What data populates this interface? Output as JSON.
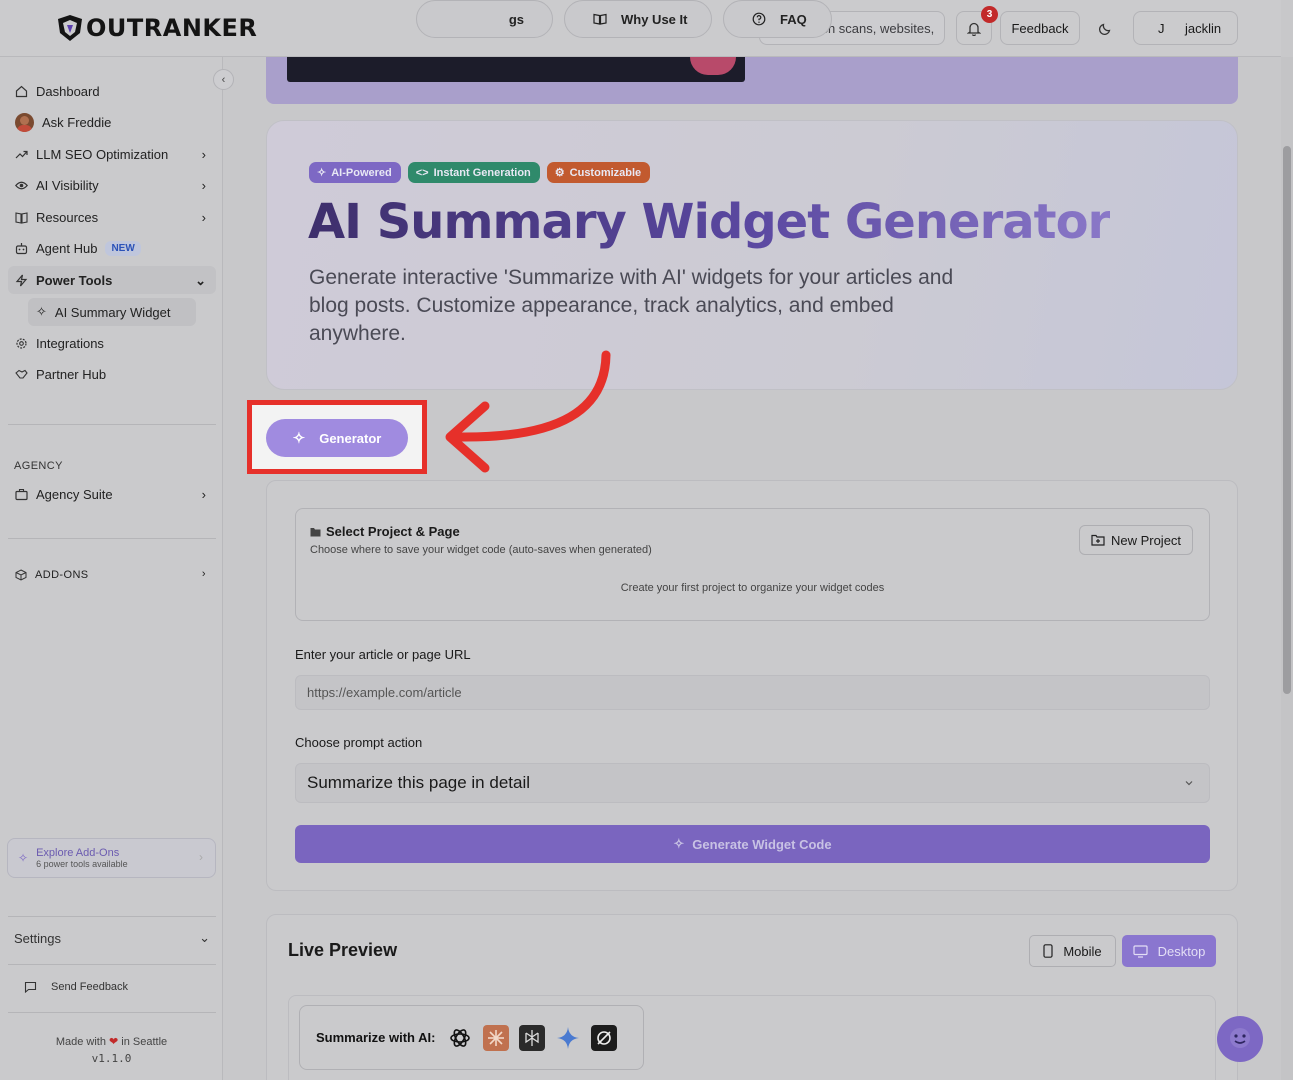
{
  "header": {
    "logo_text": "OUTRANKER",
    "search_placeholder": "Search scans, websites,",
    "notification_count": "3",
    "feedback_label": "Feedback",
    "user_initial": "J",
    "user_name": "jacklin"
  },
  "sidebar": {
    "items": [
      {
        "label": "Dashboard",
        "icon": "home-icon"
      },
      {
        "label": "Ask Freddie",
        "icon": "avatar"
      },
      {
        "label": "LLM SEO Optimization",
        "icon": "trend-icon"
      },
      {
        "label": "AI Visibility",
        "icon": "eye-icon"
      },
      {
        "label": "Resources",
        "icon": "book-icon"
      },
      {
        "label": "Agent Hub",
        "icon": "robot-icon",
        "badge": "NEW"
      },
      {
        "label": "Power Tools",
        "icon": "bolt-icon"
      },
      {
        "label": "AI Summary Widget",
        "icon": "sparkle-icon"
      },
      {
        "label": "Integrations",
        "icon": "gear-icon"
      },
      {
        "label": "Partner Hub",
        "icon": "handshake-icon"
      }
    ],
    "agency_section": "AGENCY",
    "agency_suite": "Agency Suite",
    "addons_section": "ADD-ONS",
    "explore_title": "Explore Add-Ons",
    "explore_sub": "6 power tools available",
    "settings": "Settings",
    "send_feedback": "Send Feedback",
    "made_with_prefix": "Made with",
    "made_with_suffix": "in Seattle",
    "version": "v1.1.0"
  },
  "hero": {
    "tags": [
      "AI-Powered",
      "Instant Generation",
      "Customizable"
    ],
    "title": "AI Summary Widget Generator",
    "description": "Generate interactive 'Summarize with AI' widgets for your articles and blog posts. Customize appearance, track analytics, and embed anywhere."
  },
  "tabs": {
    "generator": "Generator",
    "hidden_fragment": "gs",
    "why": "Why Use It",
    "faq": "FAQ"
  },
  "form": {
    "project_title": "Select Project & Page",
    "project_sub": "Choose where to save your widget code (auto-saves when generated)",
    "new_project": "New Project",
    "empty_projects": "Create your first project to organize your widget codes",
    "url_label": "Enter your article or page URL",
    "url_placeholder": "https://example.com/article",
    "prompt_label": "Choose prompt action",
    "prompt_value": "Summarize this page in detail",
    "generate_label": "Generate Widget Code"
  },
  "preview": {
    "title": "Live Preview",
    "mobile": "Mobile",
    "desktop": "Desktop",
    "summarize_label": "Summarize with AI:",
    "ai_icons": [
      "chatgpt-icon",
      "claude-icon",
      "perplexity-icon",
      "gemini-icon",
      "grok-icon"
    ]
  },
  "colors": {
    "accent": "#a08be0",
    "annotation": "#e6302a"
  }
}
